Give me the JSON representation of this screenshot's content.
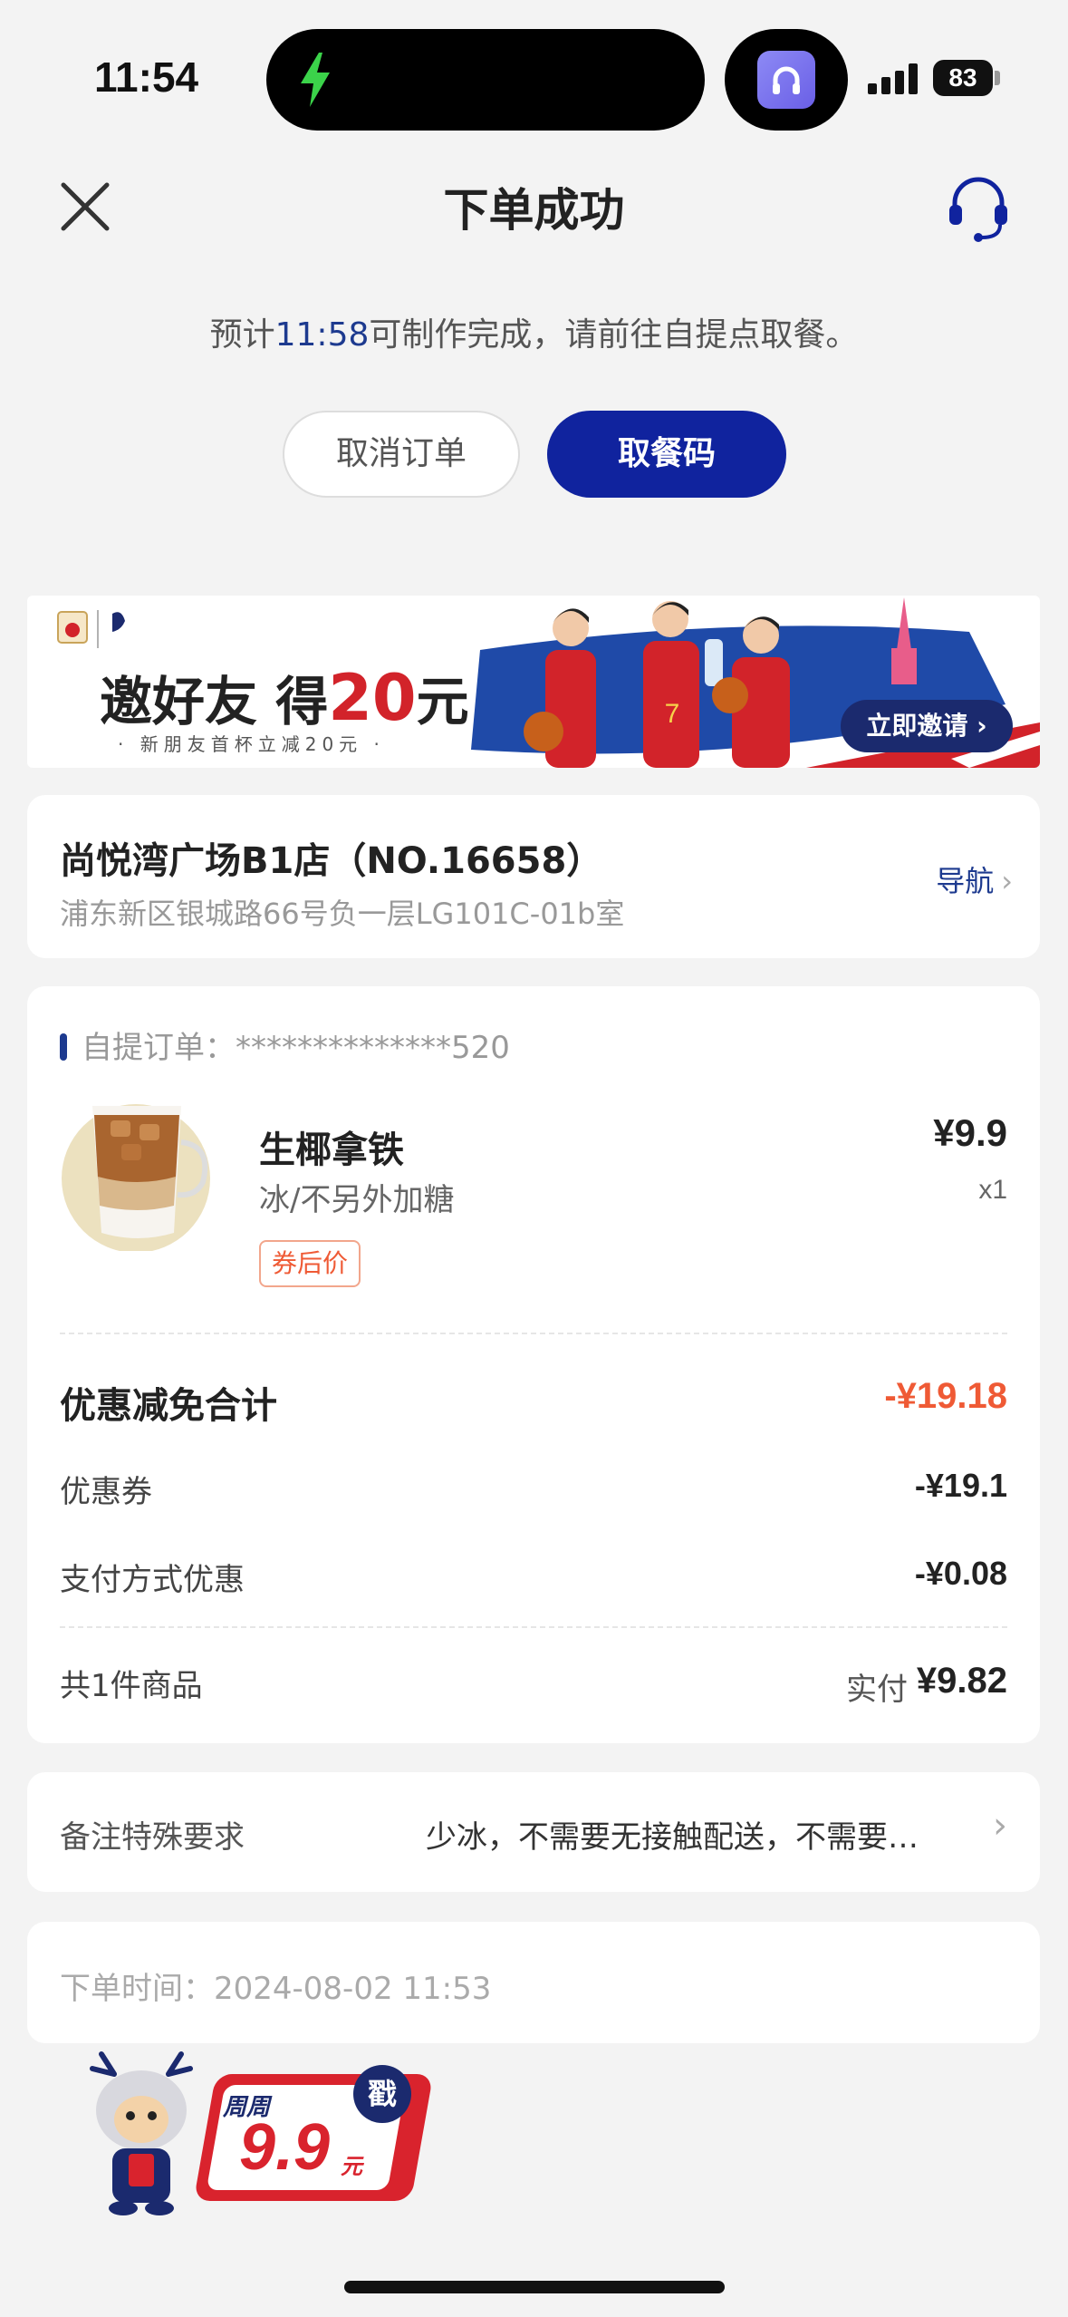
{
  "status_bar": {
    "time": "11:54",
    "battery": "83"
  },
  "header": {
    "title": "下单成功"
  },
  "eta": {
    "prefix": "预计",
    "time": "11:58",
    "suffix": "可制作完成，请前往自提点取餐。"
  },
  "actions": {
    "cancel_label": "取消订单",
    "pickup_code_label": "取餐码"
  },
  "banner": {
    "headline_prefix": "邀好友 得",
    "headline_amount": "20",
    "headline_unit": "元",
    "subline": "· 新朋友首杯立减20元 ·",
    "invite_label": "立即邀请"
  },
  "store": {
    "name": "尚悦湾广场B1店（NO.16658）",
    "address": "浦东新区银城路66号负一层LG101C-01b室",
    "nav_label": "导航"
  },
  "order": {
    "label_prefix": "自提订单：",
    "number_masked": "**************520",
    "product": {
      "name": "生椰拿铁",
      "spec": "冰/不另外加糖",
      "tag": "券后价",
      "price": "¥9.9",
      "qty": "x1"
    },
    "discount_total_label": "优惠减免合计",
    "discount_total": "-¥19.18",
    "coupon_label": "优惠券",
    "coupon_value": "-¥19.1",
    "payment_discount_label": "支付方式优惠",
    "payment_discount_value": "-¥0.08",
    "items_count_label": "共1件商品",
    "paid_label": "实付",
    "paid_value": "¥9.82"
  },
  "remark": {
    "label": "备注特殊要求",
    "value": "少冰，不需要无接触配送，不需要…"
  },
  "order_time": {
    "label": "下单时间：",
    "value": "2024-08-02 11:53"
  },
  "promo": {
    "weekly": "周周",
    "amount": "9.9",
    "unit": "元",
    "stamp": "戳"
  },
  "colors": {
    "brand_blue": "#10239e",
    "accent_orange": "#ef5a35",
    "background": "#f3f3f3"
  }
}
